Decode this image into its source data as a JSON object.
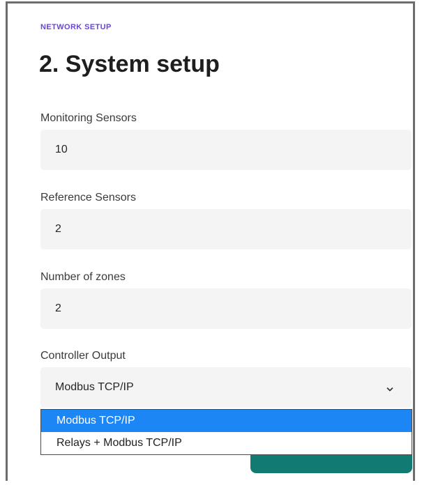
{
  "header": {
    "eyebrow": "NETWORK SETUP",
    "title": "2. System setup"
  },
  "fields": {
    "monitoring_sensors": {
      "label": "Monitoring Sensors",
      "value": "10"
    },
    "reference_sensors": {
      "label": "Reference Sensors",
      "value": "2"
    },
    "number_of_zones": {
      "label": "Number of zones",
      "value": "2"
    },
    "controller_output": {
      "label": "Controller Output",
      "value": "Modbus TCP/IP",
      "options": [
        "Modbus TCP/IP",
        "Relays + Modbus TCP/IP"
      ],
      "selected_index": 0
    }
  },
  "icons": {
    "select_chevron": "chevron-down-icon"
  },
  "colors": {
    "accent": "#6b45d9",
    "field_background": "#f4f4f4",
    "selected_option": "#1d86f5",
    "action_button": "#117b72"
  }
}
